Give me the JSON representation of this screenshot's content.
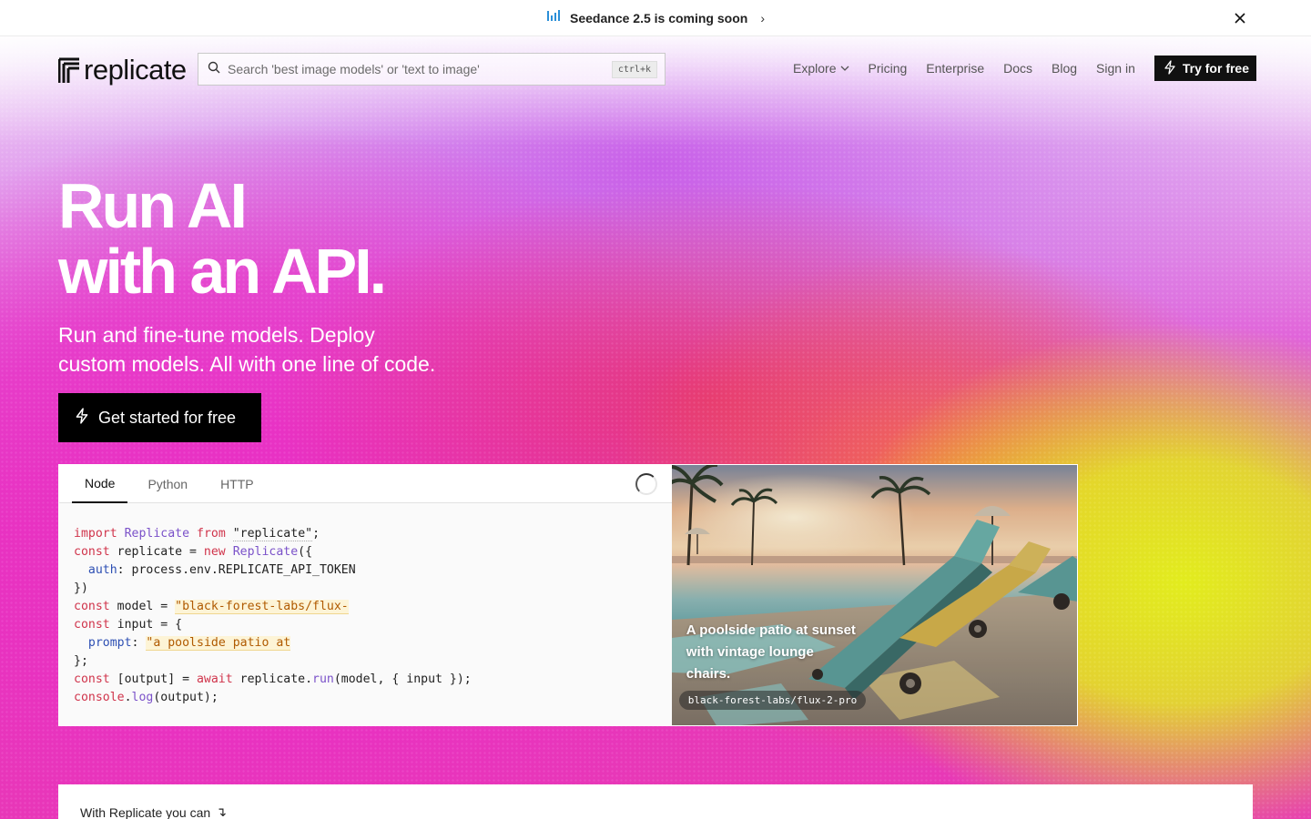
{
  "announcement": {
    "text": "Seedance 2.5 is coming soon",
    "chevron": "›",
    "icon": "bar-chart-icon",
    "close_icon": "close-icon"
  },
  "nav": {
    "logo_text": "replicate",
    "search_placeholder": "Search 'best image models' or 'text to image'",
    "search_shortcut": "ctrl+k",
    "links": [
      "Explore",
      "Pricing",
      "Enterprise",
      "Docs",
      "Blog",
      "Sign in"
    ],
    "try_label": "Try for free"
  },
  "hero": {
    "line1": "Run AI",
    "line2": "with an API.",
    "subtitle_line1": "Run and fine-tune models. Deploy",
    "subtitle_line2": "custom models. All with one line of code.",
    "cta_label": "Get started for free"
  },
  "demo": {
    "tabs": [
      "Node",
      "Python",
      "HTTP"
    ],
    "active_tab": "Node",
    "code_lines": [
      "import Replicate from \"replicate\";",
      "const replicate = new Replicate({",
      "  auth: process.env.REPLICATE_API_TOKEN",
      "})",
      "const model = \"black-forest-labs/flux-",
      "const input = {",
      "  prompt: \"a poolside patio at",
      "};",
      "const [output] = await replicate.run(model, { input });",
      "console.log(output);"
    ],
    "image_caption": "A poolside patio at sunset with vintage lounge chairs.",
    "model_name": "black-forest-labs/flux-2-pro"
  },
  "bottom": {
    "text": "With Replicate you can",
    "arrow": "↴"
  },
  "colors": {
    "magenta": "#e92fc4",
    "orange": "#f07840",
    "yellow": "#e2ec1e",
    "announce_icon": "#2b8fd8"
  }
}
